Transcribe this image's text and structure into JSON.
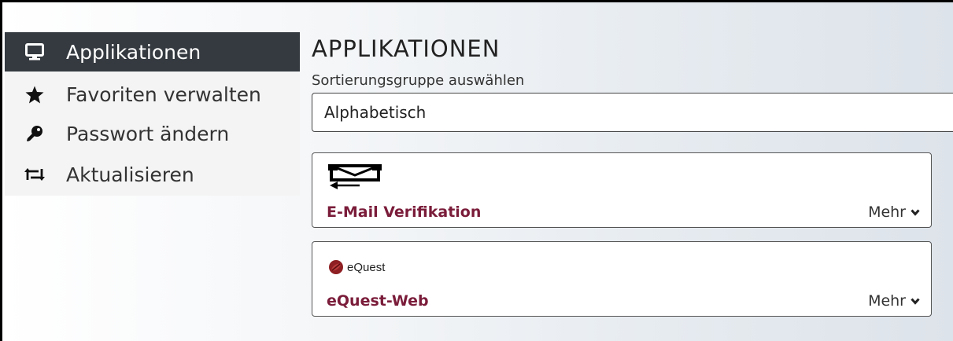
{
  "sidebar": {
    "items": [
      {
        "label": "Applikationen",
        "icon": "monitor-icon",
        "active": true
      },
      {
        "label": "Favoriten verwalten",
        "icon": "star-icon",
        "active": false
      },
      {
        "label": "Passwort ändern",
        "icon": "key-icon",
        "active": false
      },
      {
        "label": "Aktualisieren",
        "icon": "refresh-icon",
        "active": false
      }
    ]
  },
  "main": {
    "title": "APPLIKATIONEN",
    "sort_label": "Sortierungsgruppe auswählen",
    "sort_value": "Alphabetisch",
    "apps": [
      {
        "name": "E-Mail Verifikation",
        "more": "Mehr",
        "logo": "mail-return-icon"
      },
      {
        "name": "eQuest-Web",
        "more": "Mehr",
        "logo": "equest-logo",
        "logo_text": "eQuest"
      }
    ]
  },
  "colors": {
    "sidebar_active_bg": "#343a40",
    "app_name": "#7a1c3a"
  }
}
